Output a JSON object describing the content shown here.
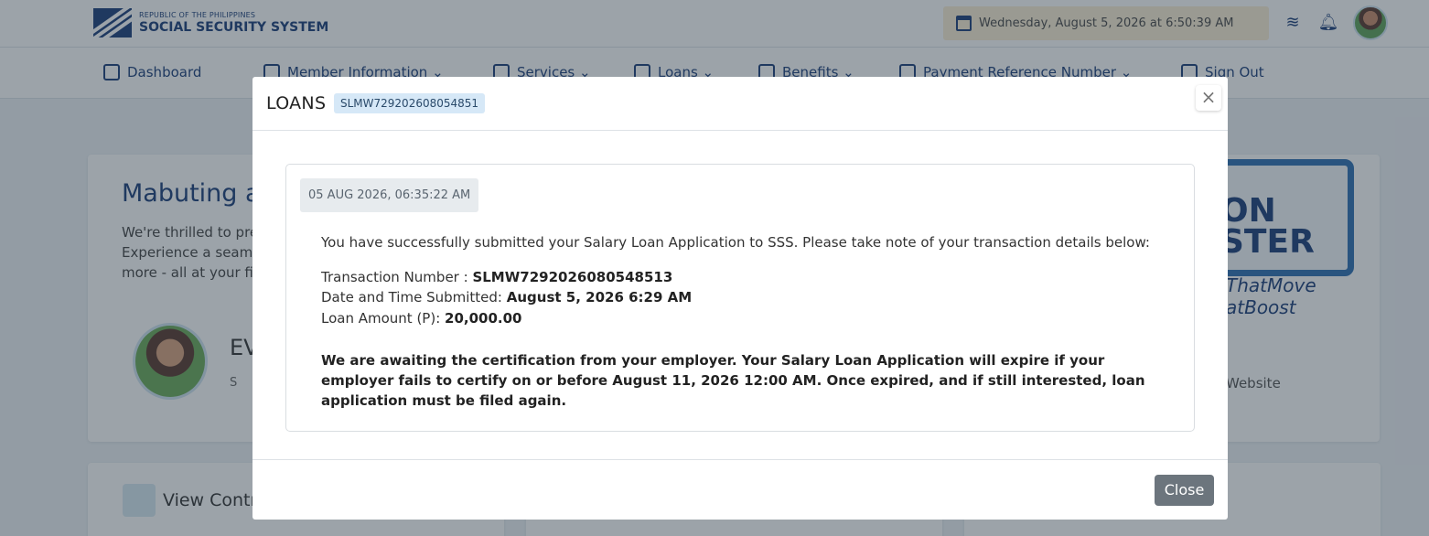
{
  "header": {
    "logo_sub": "REPUBLIC OF THE PHILIPPINES",
    "logo_main": "SOCIAL SECURITY SYSTEM",
    "datetime": "Wednesday, August 5, 2026 at 6:50:39 AM",
    "icons": [
      "layers-icon",
      "bell-icon",
      "avatar"
    ]
  },
  "nav": {
    "dashboard": "Dashboard",
    "member_info": "Member Information ⌄",
    "services": "Services ⌄",
    "loans": "Loans ⌄",
    "benefits": "Benefits ⌄",
    "payment_ref": "Payment Reference Number ⌄",
    "sign_out": "Sign Out"
  },
  "background": {
    "welcome_title": "Mabuting a",
    "welcome_lines": [
      "We're thrilled to pre",
      "Experience a seam",
      "more - all at your fin"
    ],
    "profile_name": "EV",
    "profile_sub": "S",
    "promo_text": [
      "ON",
      "STER"
    ],
    "promo_script": [
      "ThatMove",
      "atBoost"
    ],
    "promo_link": "Website",
    "contrib_label": "View Contr"
  },
  "modal": {
    "title": "LOANS",
    "txn_badge": "SLMW729202608054851",
    "close_x": "×",
    "timestamp": "05 AUG 2026, 06:35:22 AM",
    "message": "You have successfully submitted your Salary Loan Application to SSS. Please take note of your transaction details below:",
    "details": {
      "txn_label": "Transaction Number : ",
      "txn_value": "SLMW7292026080548513",
      "date_label": "Date and Time Submitted: ",
      "date_value": "August 5, 2026 6:29 AM",
      "amount_label": "Loan Amount (P): ",
      "amount_value": "20,000.00"
    },
    "notice": "We are awaiting the certification from your employer. Your Salary Loan Application will expire if your employer fails to certify on or before August 11, 2026 12:00 AM. Once expired, and if still interested, loan application must be filed again.",
    "close_button": "Close"
  }
}
